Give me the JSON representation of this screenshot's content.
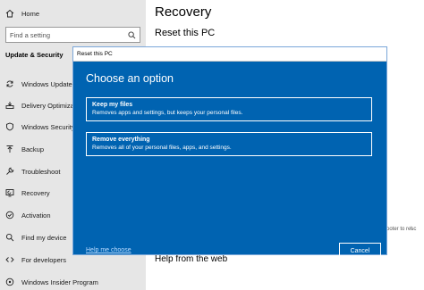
{
  "sidebar": {
    "home": "Home",
    "search_placeholder": "Find a setting",
    "section_title": "Update & Security",
    "items": [
      {
        "label": "Windows Update"
      },
      {
        "label": "Delivery Optimization"
      },
      {
        "label": "Windows Security"
      },
      {
        "label": "Backup"
      },
      {
        "label": "Troubleshoot"
      },
      {
        "label": "Recovery"
      },
      {
        "label": "Activation"
      },
      {
        "label": "Find my device"
      },
      {
        "label": "For developers"
      },
      {
        "label": "Windows Insider Program"
      }
    ]
  },
  "main": {
    "title": "Recovery",
    "subtitle": "Reset this PC",
    "help_web": "Help from the web",
    "partial_text": "ooter to resc",
    "partial_text2": "\\"
  },
  "dialog": {
    "window_title": "Reset this PC",
    "heading": "Choose an option",
    "options": [
      {
        "title": "Keep my files",
        "desc": "Removes apps and settings, but keeps your personal files."
      },
      {
        "title": "Remove everything",
        "desc": "Removes all of your personal files, apps, and settings."
      }
    ],
    "help_link": "Help me choose",
    "cancel_label": "Cancel"
  },
  "colors": {
    "dialog_bg": "#0063b1",
    "sidebar_bg": "#e6e6e6"
  }
}
